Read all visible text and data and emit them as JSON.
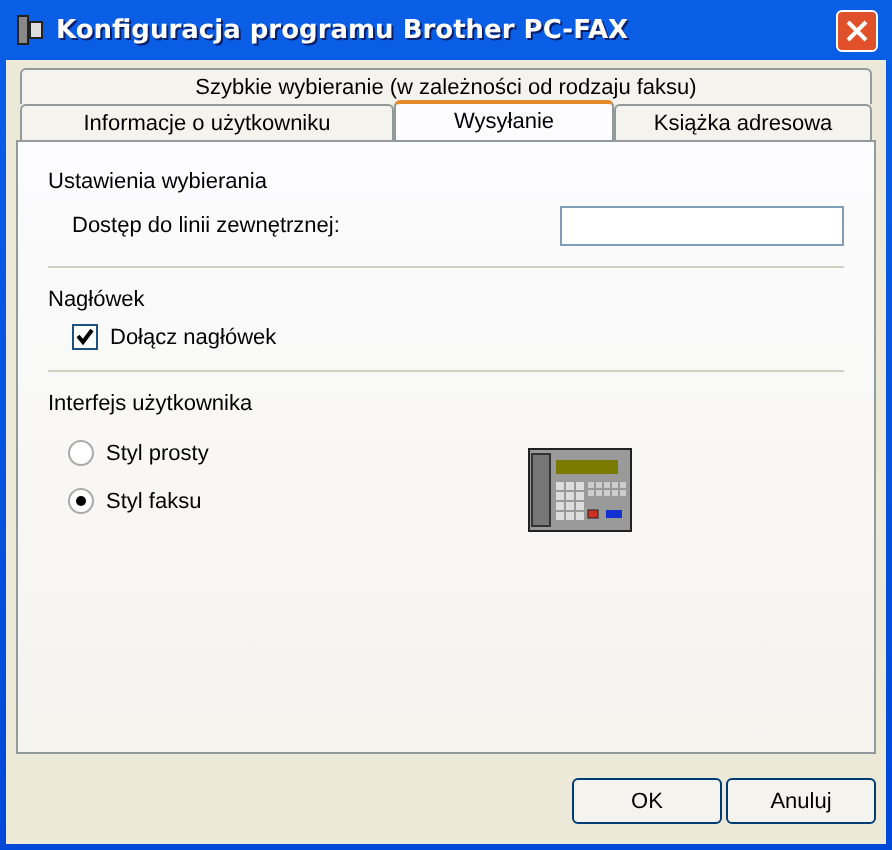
{
  "window": {
    "title": "Konfiguracja programu Brother PC-FAX"
  },
  "tab_rows": [
    [
      {
        "label": "Szybkie wybieranie (w zależności od rodzaju faksu)",
        "selected": false
      }
    ],
    [
      {
        "label": "Informacje o użytkowniku",
        "selected": false
      },
      {
        "label": "Wysyłanie",
        "selected": true
      },
      {
        "label": "Książka adresowa",
        "selected": false
      }
    ]
  ],
  "sections": [
    {
      "title": "Ustawienia wybierania",
      "kind": "field",
      "label": "Dostęp do linii zewnętrznej:"
    },
    {
      "title": "Nagłówek",
      "kind": "checkbox",
      "label": "Dołącz nagłówek",
      "checked": true
    },
    {
      "title": "Interfejs użytkownika",
      "kind": "radio",
      "options": [
        {
          "label": "Styl prosty",
          "selected": false
        },
        {
          "label": "Styl faksu",
          "selected": true
        }
      ]
    }
  ],
  "buttons": [
    "OK",
    "Anuluj"
  ]
}
